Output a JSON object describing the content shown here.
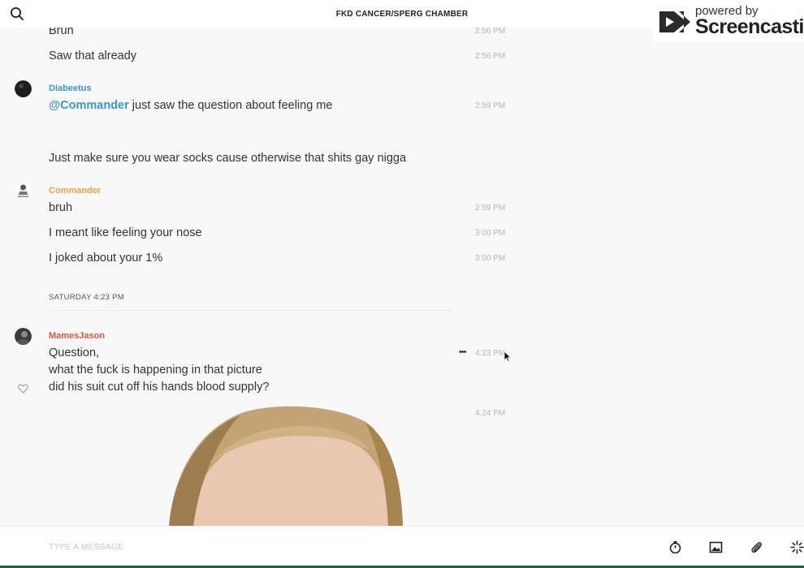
{
  "header": {
    "title": "FKD CANCER/SPERG CHAMBER"
  },
  "watermark": {
    "line1": "powered by",
    "brand": "Screencastify"
  },
  "chat": {
    "m1": {
      "text": "Bruh",
      "time": "2:56 PM"
    },
    "m2": {
      "text": "Saw that already",
      "time": "2:56 PM"
    },
    "g2": {
      "author": "Diabeetus",
      "author_color": "#3b97c5",
      "m1": {
        "mention": "@Commander",
        "text": " just saw the question about feeling me",
        "time": "2:59 PM"
      },
      "m2": {
        "text": "Just make sure you wear socks cause otherwise that shits gay nigga"
      }
    },
    "g3": {
      "author": "Commander",
      "author_color": "#e8a24a",
      "m1": {
        "text": "bruh",
        "time": "2:59 PM"
      },
      "m2": {
        "text": "I meant like feeling your nose",
        "time": "3:00 PM"
      },
      "m3": {
        "text": "I joked about your 1%",
        "time": "3:00 PM"
      }
    },
    "day_separator": "SATURDAY 4:23 PM",
    "g4": {
      "author": "MamesJason",
      "author_color": "#d9553c",
      "m1": {
        "line1": "Question,",
        "line2": "what the fuck is happening  in that picture",
        "line3": "did his suit cut off his hands blood supply?",
        "time": "4:23 PM",
        "more": "•••"
      },
      "m2": {
        "time": "4:24 PM"
      }
    }
  },
  "composer": {
    "placeholder": "TYPE A MESSAGE"
  },
  "colors": {
    "mention": "#3b97c5",
    "background": "#f8f8f9",
    "timestamp": "#b5b5b5"
  },
  "icons": [
    "search-icon",
    "phone-icon",
    "info-icon",
    "heart-icon",
    "more-icon",
    "timer-icon",
    "image-icon",
    "paperclip-icon",
    "sparkle-icon",
    "cursor-icon"
  ]
}
